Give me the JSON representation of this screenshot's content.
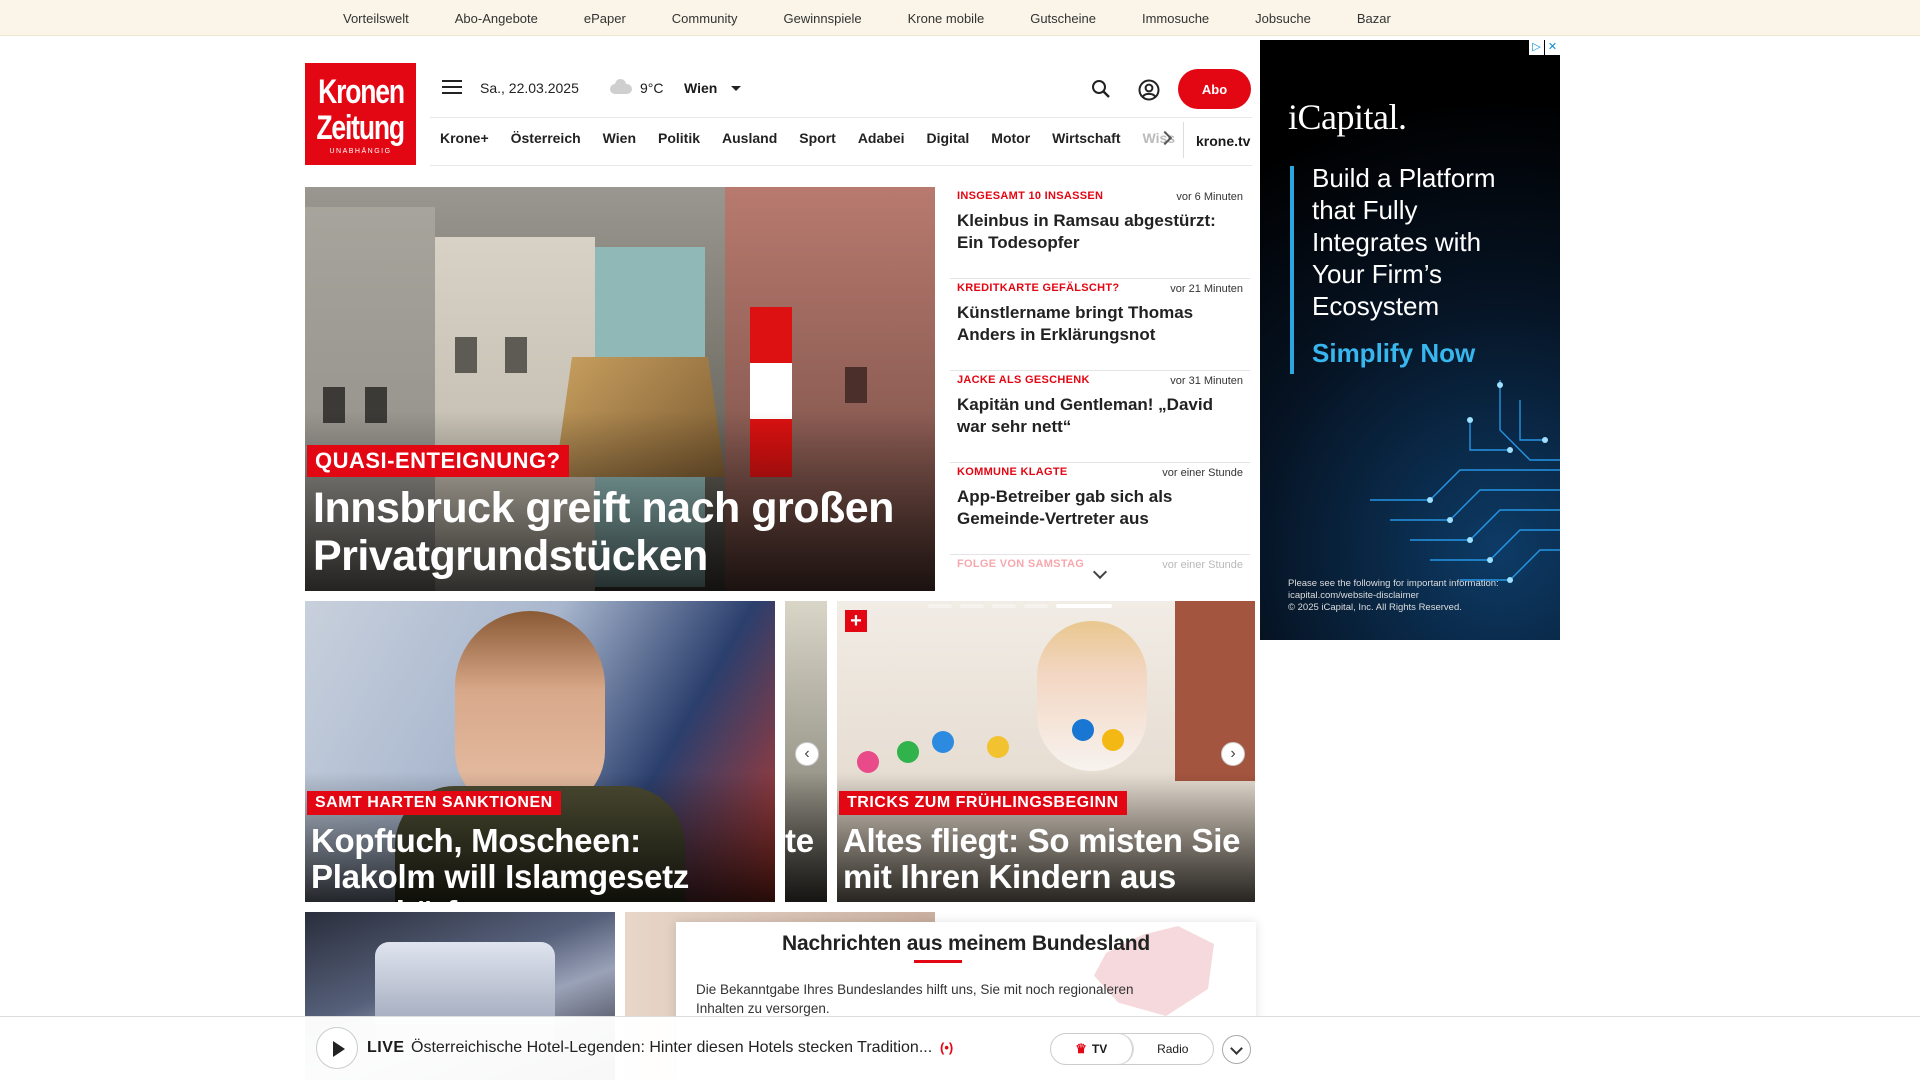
{
  "topbar": {
    "links": [
      "Vorteilswelt",
      "Abo-Angebote",
      "ePaper",
      "Community",
      "Gewinnspiele",
      "Krone mobile",
      "Gutscheine",
      "Immosuche",
      "Jobsuche",
      "Bazar"
    ]
  },
  "logo": {
    "line1": "Kronen",
    "line2": "Zeitung",
    "tag": "UNABHÄNGIG"
  },
  "header": {
    "date": "Sa., 22.03.2025",
    "temperature": "9°C",
    "city": "Wien",
    "abo_label": "Abo"
  },
  "nav": {
    "items": [
      "Krone+",
      "Österreich",
      "Wien",
      "Politik",
      "Ausland",
      "Sport",
      "Adabei",
      "Digital",
      "Motor",
      "Wirtschaft"
    ],
    "faded": "Wiss",
    "tv": "krone.tv"
  },
  "hero": {
    "kicker": "QUASI-ENTEIGNUNG?",
    "title": "Innsbruck greift nach großen Privatgrundstücken"
  },
  "ticker": [
    {
      "kicker": "INSGESAMT 10 INSASSEN",
      "time": "vor 6 Minuten",
      "headline": "Kleinbus in Ramsau abgestürzt: Ein Todesopfer"
    },
    {
      "kicker": "KREDITKARTE GEFÄLSCHT?",
      "time": "vor 21 Minuten",
      "headline": "Künstlername bringt Thomas Anders in Erklärungsnot"
    },
    {
      "kicker": "JACKE ALS GESCHENK",
      "time": "vor 31 Minuten",
      "headline": "Kapitän und Gentleman! „David war sehr nett“"
    },
    {
      "kicker": "KOMMUNE KLAGTE",
      "time": "vor einer Stunde",
      "headline": "App-Betreiber gab sich als Gemeinde-Vertreter aus"
    },
    {
      "kicker": "FOLGE VON SAMSTAG",
      "time": "vor einer Stunde",
      "headline": ""
    }
  ],
  "cards": {
    "left": {
      "kicker": "SAMT HARTEN SANKTIONEN",
      "title": "Kopftuch, Moscheen: Plakolm will Islamgesetz verschärfen"
    },
    "middle": {
      "title": "te"
    },
    "right": {
      "kicker": "TRICKS ZUM FRÜHLINGSBEGINN",
      "title": "Altes fliegt: So misten Sie mit Ihren Kindern aus",
      "badge": "+"
    }
  },
  "bundesland": {
    "title": "Nachrichten aus meinem Bundesland",
    "text": "Die Bekanntgabe Ihres Bundeslandes hilft uns, Sie mit noch regionaleren Inhalten zu versorgen."
  },
  "ad": {
    "brand": "iCapital.",
    "headline": "Build a Platform that Fully Integrates with Your Firm’s Ecosystem",
    "cta": "Simplify Now",
    "legal1": "Please see the following for important information:",
    "legal2": "icapital.com/website-disclaimer",
    "legal3": "© 2025 iCapital, Inc. All Rights Reserved."
  },
  "livebar": {
    "label": "LIVE",
    "text": "Österreichische Hotel-Legenden: Hinter diesen Hotels stecken Tradition...",
    "tv": "TV",
    "radio": "Radio"
  },
  "colors": {
    "brand": "#e30613",
    "topbar_bg": "#faf5e8",
    "ad_accent": "#38b6ee"
  }
}
